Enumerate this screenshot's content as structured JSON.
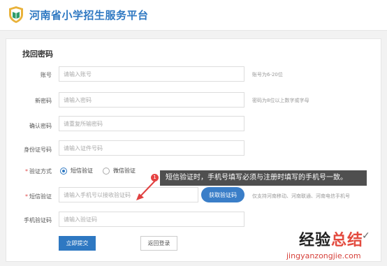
{
  "site": {
    "title": "河南省小学招生服务平台"
  },
  "form": {
    "title": "找回密码",
    "account": {
      "label": "账号",
      "placeholder": "请输入账号",
      "hint": "账号为6-20位"
    },
    "new_password": {
      "label": "新密码",
      "placeholder": "请输入密码",
      "hint": "密码为8位以上数字或字母"
    },
    "confirm_password": {
      "label": "确认密码",
      "placeholder": "请重复所输密码"
    },
    "id_number": {
      "label": "身份证号码",
      "placeholder": "请输入证件号码"
    },
    "verify_method": {
      "label": "验证方式",
      "options": [
        {
          "label": "短信验证",
          "selected": true
        },
        {
          "label": "微信验证",
          "selected": false
        }
      ]
    },
    "sms": {
      "label": "短信验证",
      "placeholder": "请输入手机号以接收验证码",
      "button": "获取验证码",
      "hint": "仅支持河南移动、河南联通、河南电信手机号"
    },
    "phone_code": {
      "label": "手机验证码",
      "placeholder": "请输入验证码"
    },
    "submit": "立即提交",
    "back": "返回登录"
  },
  "annotation": {
    "badge": "1",
    "text": "短信验证时，手机号填写必须与注册时填写的手机号一致。"
  },
  "watermark": {
    "title_left": "经验",
    "title_right": "总结",
    "url": "jingyanzongjie.com"
  },
  "colors": {
    "brand": "#2e78c2",
    "required": "#e04a4a",
    "badge": "#e64343"
  }
}
